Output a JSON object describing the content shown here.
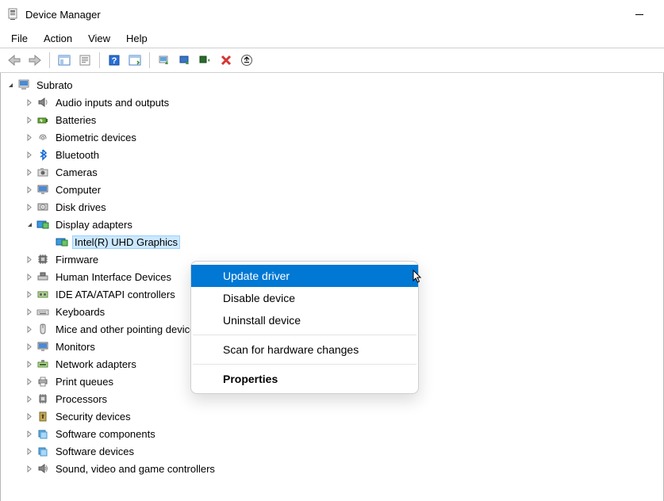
{
  "window": {
    "title": "Device Manager"
  },
  "menubar": {
    "file": "File",
    "action": "Action",
    "view": "View",
    "help": "Help"
  },
  "tree": {
    "root": "Subrato",
    "nodes": [
      {
        "label": "Audio inputs and outputs",
        "icon": "speaker"
      },
      {
        "label": "Batteries",
        "icon": "battery"
      },
      {
        "label": "Biometric devices",
        "icon": "fingerprint"
      },
      {
        "label": "Bluetooth",
        "icon": "bluetooth"
      },
      {
        "label": "Cameras",
        "icon": "camera"
      },
      {
        "label": "Computer",
        "icon": "monitor"
      },
      {
        "label": "Disk drives",
        "icon": "disk"
      },
      {
        "label": "Display adapters",
        "icon": "display",
        "expanded": true,
        "children": [
          {
            "label": "Intel(R) UHD Graphics",
            "icon": "display",
            "selected": true
          }
        ]
      },
      {
        "label": "Firmware",
        "icon": "chip"
      },
      {
        "label": "Human Interface Devices",
        "icon": "hid"
      },
      {
        "label": "IDE ATA/ATAPI controllers",
        "icon": "ide"
      },
      {
        "label": "Keyboards",
        "icon": "keyboard"
      },
      {
        "label": "Mice and other pointing devices",
        "icon": "mouse"
      },
      {
        "label": "Monitors",
        "icon": "monitor"
      },
      {
        "label": "Network adapters",
        "icon": "network"
      },
      {
        "label": "Print queues",
        "icon": "printer"
      },
      {
        "label": "Processors",
        "icon": "cpu"
      },
      {
        "label": "Security devices",
        "icon": "security"
      },
      {
        "label": "Software components",
        "icon": "software"
      },
      {
        "label": "Software devices",
        "icon": "software"
      },
      {
        "label": "Sound, video and game controllers",
        "icon": "sound"
      }
    ]
  },
  "context_menu": {
    "update": "Update driver",
    "disable": "Disable device",
    "uninstall": "Uninstall device",
    "scan": "Scan for hardware changes",
    "properties": "Properties"
  }
}
